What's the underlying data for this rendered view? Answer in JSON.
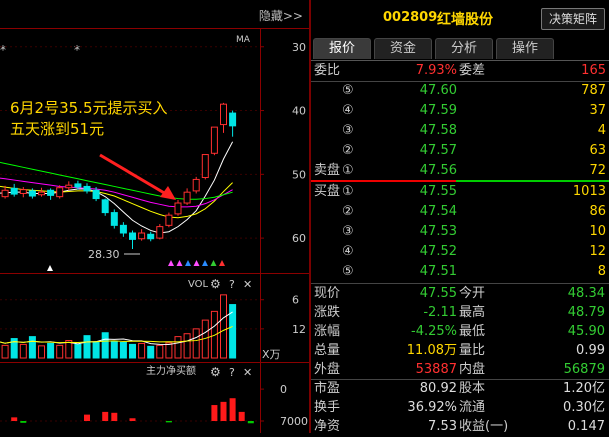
{
  "chart_panel": {
    "hide_label": "隐藏>>",
    "ma_label": "MA",
    "star_marks": [
      "*",
      "*"
    ],
    "annotation_line1": "6月2号35.5元提示买入",
    "annotation_line2": "五天涨到51元",
    "low_label": "28.30",
    "price_axis": [
      "60",
      "50",
      "40",
      "30"
    ],
    "vol_label": "VOL",
    "vol_axis": [
      "12",
      "6"
    ],
    "vol_unit": "X万",
    "net_label": "主力净买额",
    "net_axis": [
      "7000",
      "0"
    ],
    "help_glyph": "?",
    "close_glyph": "✕"
  },
  "chart_data": [
    {
      "type": "candlestick",
      "title": "",
      "ylim": [
        25,
        62
      ],
      "yticks": [
        30,
        40,
        50,
        60
      ],
      "candles": [
        {
          "o": 37.2,
          "c": 36.8,
          "h": 38.0,
          "l": 36.0
        },
        {
          "o": 36.5,
          "c": 37.5,
          "h": 38.2,
          "l": 36.2
        },
        {
          "o": 37.8,
          "c": 36.9,
          "h": 38.5,
          "l": 36.5
        },
        {
          "o": 37.0,
          "c": 37.6,
          "h": 38.0,
          "l": 36.4
        },
        {
          "o": 37.4,
          "c": 36.6,
          "h": 37.8,
          "l": 36.2
        },
        {
          "o": 36.8,
          "c": 37.2,
          "h": 37.9,
          "l": 36.5
        },
        {
          "o": 37.5,
          "c": 36.7,
          "h": 37.8,
          "l": 36.0
        },
        {
          "o": 36.5,
          "c": 37.9,
          "h": 38.3,
          "l": 36.2
        },
        {
          "o": 37.9,
          "c": 38.3,
          "h": 38.9,
          "l": 37.5
        },
        {
          "o": 38.5,
          "c": 38.0,
          "h": 39.0,
          "l": 37.6
        },
        {
          "o": 38.1,
          "c": 37.4,
          "h": 38.6,
          "l": 37.0
        },
        {
          "o": 37.5,
          "c": 36.2,
          "h": 38.0,
          "l": 35.8
        },
        {
          "o": 36.0,
          "c": 34.0,
          "h": 36.2,
          "l": 33.5
        },
        {
          "o": 34.0,
          "c": 32.0,
          "h": 34.5,
          "l": 31.5
        },
        {
          "o": 32.0,
          "c": 30.8,
          "h": 32.5,
          "l": 30.2
        },
        {
          "o": 30.8,
          "c": 29.8,
          "h": 31.2,
          "l": 28.3
        },
        {
          "o": 29.9,
          "c": 30.8,
          "h": 31.4,
          "l": 29.6
        },
        {
          "o": 30.6,
          "c": 29.9,
          "h": 31.0,
          "l": 29.5
        },
        {
          "o": 30.0,
          "c": 31.8,
          "h": 32.2,
          "l": 29.8
        },
        {
          "o": 32.0,
          "c": 33.6,
          "h": 34.0,
          "l": 31.7
        },
        {
          "o": 33.8,
          "c": 35.5,
          "h": 36.0,
          "l": 33.5
        },
        {
          "o": 35.5,
          "c": 37.2,
          "h": 37.8,
          "l": 35.2
        },
        {
          "o": 37.4,
          "c": 39.2,
          "h": 39.6,
          "l": 37.0
        },
        {
          "o": 39.5,
          "c": 43.1,
          "h": 43.1,
          "l": 39.2
        },
        {
          "o": 43.3,
          "c": 47.4,
          "h": 47.4,
          "l": 43.0
        },
        {
          "o": 47.8,
          "c": 51.0,
          "h": 51.2,
          "l": 46.5
        },
        {
          "o": 49.6,
          "c": 47.6,
          "h": 50.0,
          "l": 45.9
        }
      ],
      "series": [
        {
          "color": "#ffffff",
          "values": [
            37.0,
            37.1,
            37.2,
            37.2,
            37.0,
            37.0,
            37.0,
            37.2,
            37.5,
            37.7,
            37.7,
            37.3,
            36.5,
            35.4,
            34.1,
            32.8,
            31.9,
            31.2,
            30.8,
            31.0,
            31.8,
            32.9,
            34.3,
            36.6,
            39.1,
            42.4,
            45.1
          ]
        },
        {
          "color": "#ffff00",
          "values": [
            38.2,
            38.0,
            37.8,
            37.6,
            37.5,
            37.4,
            37.3,
            37.2,
            37.3,
            37.4,
            37.4,
            37.3,
            37.0,
            36.6,
            36.0,
            35.4,
            34.8,
            34.2,
            33.7,
            33.3,
            33.2,
            33.4,
            33.8,
            34.6,
            35.8,
            37.3,
            38.7
          ]
        },
        {
          "color": "#ff00ff",
          "values": [
            39.5,
            39.3,
            39.1,
            38.9,
            38.7,
            38.5,
            38.3,
            38.1,
            38.0,
            37.9,
            37.8,
            37.7,
            37.5,
            37.2,
            36.8,
            36.4,
            36.0,
            35.6,
            35.3,
            35.0,
            34.9,
            34.9,
            35.0,
            35.4,
            36.0,
            36.8,
            37.6
          ]
        },
        {
          "color": "#00ff00",
          "values": [
            42.0,
            41.7,
            41.4,
            41.1,
            40.8,
            40.5,
            40.2,
            39.9,
            39.6,
            39.3,
            39.0,
            38.7,
            38.4,
            38.1,
            37.8,
            37.5,
            37.2,
            36.9,
            36.6,
            36.4,
            36.2,
            36.1,
            36.1,
            36.2,
            36.4,
            36.8,
            37.2
          ]
        }
      ]
    },
    {
      "type": "bar",
      "title": "VOL",
      "ylim": [
        0,
        14
      ],
      "yticks": [
        6,
        12
      ],
      "values": [
        3.5,
        2.6,
        4.0,
        2.8,
        4.4,
        2.5,
        3.0,
        2.6,
        3.6,
        2.8,
        4.6,
        3.2,
        5.2,
        3.4,
        3.2,
        2.8,
        3.0,
        2.4,
        2.6,
        3.1,
        4.4,
        5.0,
        6.0,
        7.8,
        9.6,
        13.0,
        11.0
      ],
      "colors": [
        "g",
        "r",
        "g",
        "r",
        "g",
        "r",
        "g",
        "r",
        "r",
        "g",
        "g",
        "g",
        "g",
        "g",
        "g",
        "g",
        "r",
        "g",
        "r",
        "r",
        "r",
        "r",
        "r",
        "r",
        "r",
        "r",
        "g"
      ]
    },
    {
      "type": "bar",
      "title": "主力净买额",
      "ylim": [
        -2000,
        9000
      ],
      "yticks": [
        0,
        7000
      ],
      "values": [
        1000,
        0,
        800,
        -400,
        0,
        0,
        0,
        0,
        0,
        0,
        1400,
        0,
        2000,
        1800,
        0,
        600,
        0,
        0,
        0,
        -300,
        0,
        0,
        0,
        0,
        3500,
        4200,
        5000,
        2000,
        -500
      ]
    }
  ],
  "quote_panel": {
    "code": "002809",
    "name": "红墙股份",
    "matrix_button": "决策矩阵",
    "tabs": [
      "报价",
      "资金",
      "分析",
      "操作"
    ],
    "weibi_label": "委比",
    "weibi_value": "7.93%",
    "weicha_label": "委差",
    "weicha_value": "165",
    "sell_label": "卖盘",
    "buy_label": "买盘",
    "sells": [
      {
        "n": "⑤",
        "price": "47.60",
        "vol": "787"
      },
      {
        "n": "④",
        "price": "47.59",
        "vol": "37"
      },
      {
        "n": "③",
        "price": "47.58",
        "vol": "4"
      },
      {
        "n": "②",
        "price": "47.57",
        "vol": "63"
      },
      {
        "n": "①",
        "price": "47.56",
        "vol": "72"
      }
    ],
    "buys": [
      {
        "n": "①",
        "price": "47.55",
        "vol": "1013"
      },
      {
        "n": "②",
        "price": "47.54",
        "vol": "86"
      },
      {
        "n": "③",
        "price": "47.53",
        "vol": "10"
      },
      {
        "n": "④",
        "price": "47.52",
        "vol": "12"
      },
      {
        "n": "⑤",
        "price": "47.51",
        "vol": "8"
      }
    ],
    "stats": [
      {
        "k1": "现价",
        "v1": "47.55",
        "c1": "green",
        "k2": "今开",
        "v2": "48.34",
        "c2": "green"
      },
      {
        "k1": "涨跌",
        "v1": "-2.11",
        "c1": "green",
        "k2": "最高",
        "v2": "48.79",
        "c2": "green"
      },
      {
        "k1": "涨幅",
        "v1": "-4.25%",
        "c1": "green",
        "k2": "最低",
        "v2": "45.90",
        "c2": "green"
      },
      {
        "k1": "总量",
        "v1": "11.08万",
        "c1": "yellow",
        "k2": "量比",
        "v2": "0.99",
        "c2": "white"
      },
      {
        "k1": "外盘",
        "v1": "53887",
        "c1": "red",
        "k2": "内盘",
        "v2": "56879",
        "c2": "green"
      },
      {
        "k1": "市盈",
        "v1": "80.92",
        "c1": "white",
        "k2": "股本",
        "v2": "1.20亿",
        "c2": "white"
      },
      {
        "k1": "换手",
        "v1": "36.92%",
        "c1": "white",
        "k2": "流通",
        "v2": "0.30亿",
        "c2": "white"
      },
      {
        "k1": "净资",
        "v1": "7.53",
        "c1": "white",
        "k2": "收益(一)",
        "v2": "0.147",
        "c2": "white"
      }
    ]
  }
}
